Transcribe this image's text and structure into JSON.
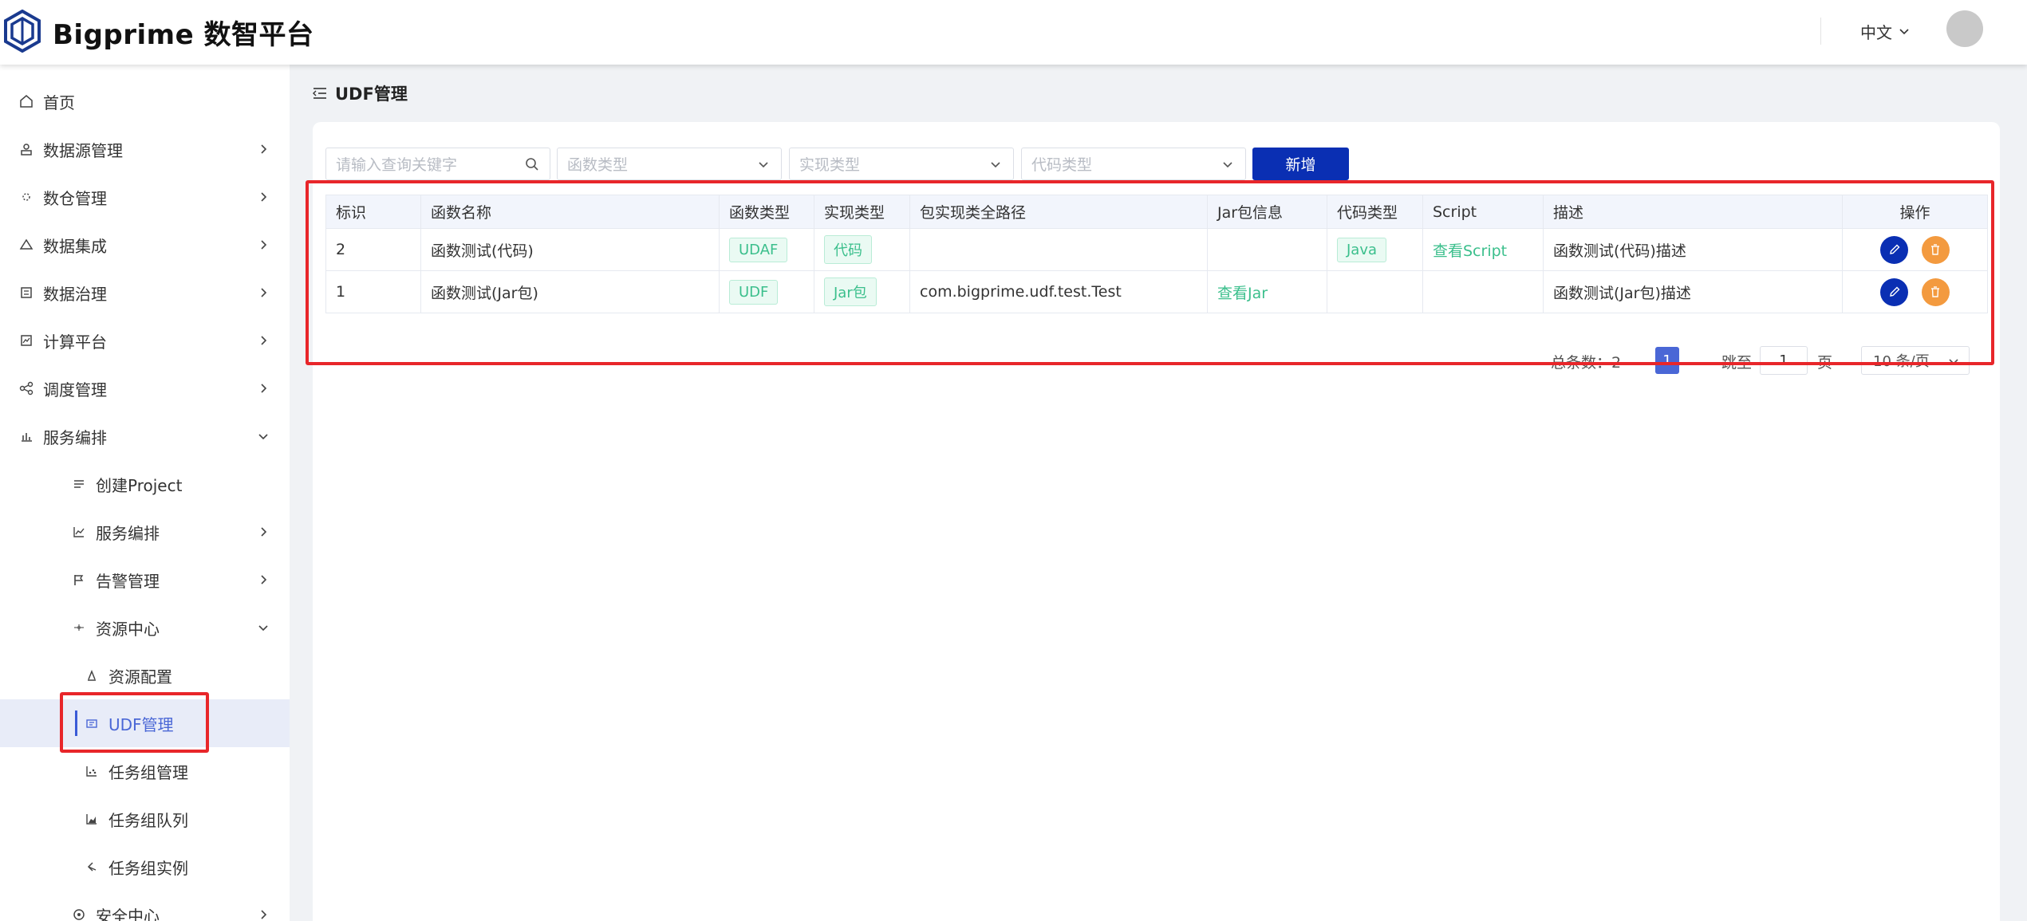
{
  "header": {
    "brand": "Bigprime 数智平台",
    "language": "中文",
    "logo_icon": "hexagon-logo-icon",
    "avatar_color": "#c9c9c9"
  },
  "sidebar": {
    "items": [
      {
        "label": "首页",
        "icon": "home-icon"
      },
      {
        "label": "数据源管理",
        "icon": "datasource-icon"
      },
      {
        "label": "数仓管理",
        "icon": "warehouse-icon"
      },
      {
        "label": "数据集成",
        "icon": "integration-icon"
      },
      {
        "label": "数据治理",
        "icon": "governance-icon"
      },
      {
        "label": "计算平台",
        "icon": "compute-icon"
      },
      {
        "label": "调度管理",
        "icon": "schedule-icon"
      },
      {
        "label": "服务编排",
        "icon": "chart-icon"
      }
    ],
    "sub_items": [
      {
        "label": "创建Project",
        "icon": "list-icon"
      },
      {
        "label": "服务编排",
        "icon": "line-chart-icon"
      },
      {
        "label": "告警管理",
        "icon": "flag-icon"
      },
      {
        "label": "资源中心",
        "icon": "resource-icon"
      }
    ],
    "leaf_items": [
      {
        "label": "资源配置",
        "icon": "config-icon"
      },
      {
        "label": "UDF管理",
        "icon": "udf-icon",
        "active": true
      },
      {
        "label": "任务组管理",
        "icon": "task-group-icon"
      },
      {
        "label": "任务组队列",
        "icon": "queue-icon"
      },
      {
        "label": "任务组实例",
        "icon": "instance-icon"
      }
    ],
    "bottom_item": {
      "label": "安全中心",
      "icon": "security-icon"
    }
  },
  "page": {
    "title": "UDF管理"
  },
  "filters": {
    "search_placeholder": "请输入查询关键字",
    "func_type_placeholder": "函数类型",
    "impl_type_placeholder": "实现类型",
    "code_type_placeholder": "代码类型",
    "add_label": "新增"
  },
  "table": {
    "headers": {
      "id": "标识",
      "name": "函数名称",
      "func_type": "函数类型",
      "impl_type": "实现类型",
      "class_path": "包实现类全路径",
      "jar_info": "Jar包信息",
      "code_type": "代码类型",
      "script": "Script",
      "desc": "描述",
      "ops": "操作"
    },
    "rows": [
      {
        "id": "2",
        "name": "函数测试(代码)",
        "func_type": "UDAF",
        "impl_type": "代码",
        "class_path": "",
        "jar_info": "",
        "code_type": "Java",
        "script": "查看Script",
        "desc": "函数测试(代码)描述"
      },
      {
        "id": "1",
        "name": "函数测试(Jar包)",
        "func_type": "UDF",
        "impl_type": "Jar包",
        "class_path": "com.bigprime.udf.test.Test",
        "jar_info": "查看Jar",
        "code_type": "",
        "script": "",
        "desc": "函数测试(Jar包)描述"
      }
    ]
  },
  "pagination": {
    "total_label": "总条数：2",
    "current_page": "1",
    "jump_label": "跳至",
    "jump_value": "1",
    "page_suffix": "页",
    "page_size": "10 条/页"
  },
  "colors": {
    "primary": "#0a2fb3",
    "active_nav": "#4a67d6",
    "tag_green": "#3bbf8c",
    "delete_orange": "#f39a3f",
    "highlight_red": "#e8262a"
  }
}
